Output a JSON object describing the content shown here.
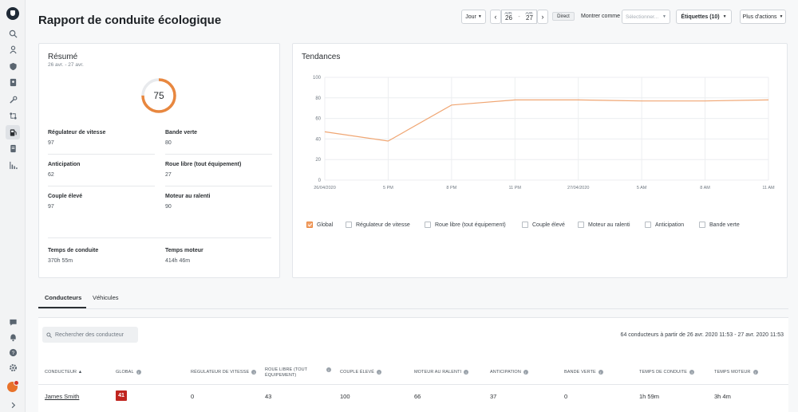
{
  "app": {
    "title": "Rapport de conduite écologique"
  },
  "header": {
    "period_label": "Jour",
    "date_start": {
      "month": "AVR.",
      "day": "26"
    },
    "date_end": {
      "month": "AVR.",
      "day": "27"
    },
    "date_separator": "-",
    "direct_label": "Direct",
    "show_as_label": "Montrer comme",
    "select_placeholder": "Sélectionner...",
    "tags_label": "Étiquettes (10)",
    "more_actions_label": "Plus d'actions"
  },
  "summary": {
    "title": "Résumé",
    "date_range": "26 avr. - 27 avr.",
    "score": "75",
    "score_fraction": 0.75,
    "metrics": [
      {
        "label": "Régulateur de vitesse",
        "value": "97"
      },
      {
        "label": "Bande verte",
        "value": "80"
      },
      {
        "label": "Anticipation",
        "value": "62"
      },
      {
        "label": "Roue libre (tout équipement)",
        "value": "27"
      },
      {
        "label": "Couple élevé",
        "value": "97"
      },
      {
        "label": "Moteur au ralenti",
        "value": "90"
      },
      {
        "label": "Temps de conduite",
        "value": "370h 55m"
      },
      {
        "label": "Temps moteur",
        "value": "414h 46m"
      }
    ]
  },
  "trends": {
    "title": "Tendances",
    "legend": [
      {
        "label": "Global",
        "checked": true
      },
      {
        "label": "Régulateur de vitesse",
        "checked": false
      },
      {
        "label": "Roue libre (tout équipement)",
        "checked": false
      },
      {
        "label": "Couple élevé",
        "checked": false
      },
      {
        "label": "Moteur au ralenti",
        "checked": false
      },
      {
        "label": "Anticipation",
        "checked": false
      },
      {
        "label": "Bande verte",
        "checked": false
      }
    ]
  },
  "chart_data": {
    "type": "line",
    "title": "Tendances",
    "x": [
      "26/04/2020",
      "5 PM",
      "8 PM",
      "11 PM",
      "27/04/2020",
      "5 AM",
      "8 AM",
      "11 AM"
    ],
    "ylim": [
      0,
      100
    ],
    "yticks": [
      0,
      20,
      40,
      60,
      80,
      100
    ],
    "grid": true,
    "series": [
      {
        "name": "Global",
        "color": "#f0a673",
        "values": [
          47,
          38,
          73,
          78,
          78,
          77,
          77,
          78
        ]
      }
    ]
  },
  "tabs": [
    {
      "label": "Conducteurs",
      "active": true
    },
    {
      "label": "Véhicules",
      "active": false
    }
  ],
  "table": {
    "search_placeholder": "Rechercher des conducteur",
    "count_text": "64 conducteurs à partir de 26 avr. 2020 11:53 - 27 avr. 2020 11:53",
    "columns": [
      "CONDUCTEUR ▲",
      "GLOBAL",
      "RÉGULATEUR DE VITESSE",
      "ROUE LIBRE (TOUT ÉQUIPEMENT)",
      "COUPLE ÉLEVÉ",
      "MOTEUR AU RALENTI",
      "ANTICIPATION",
      "BANDE VERTE",
      "TEMPS DE CONDUITE",
      "TEMPS MOTEUR"
    ],
    "rows": [
      {
        "driver": "James Smith",
        "global": "41",
        "speed": "0",
        "coast": "43",
        "torque": "100",
        "idle": "66",
        "anticipation": "37",
        "green": "0",
        "drive_time": "1h 59m",
        "engine_time": "3h 4m"
      }
    ]
  },
  "colors": {
    "accent": "#e8873f",
    "badge_red": "#c0241f"
  }
}
